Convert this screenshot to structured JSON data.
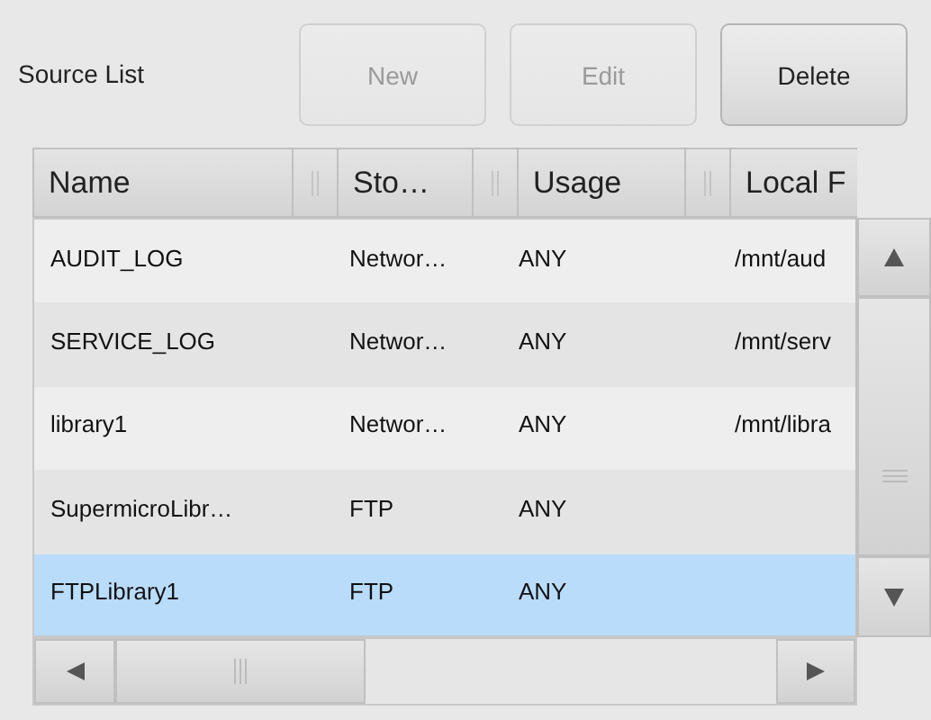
{
  "panel_label": "Source List",
  "buttons": [
    {
      "label": "New",
      "disabled": true
    },
    {
      "label": "Edit",
      "disabled": true
    },
    {
      "label": "Delete",
      "disabled": false
    }
  ],
  "table": {
    "columns": [
      "Name",
      "Sto…",
      "Usage",
      "Local F"
    ],
    "rows": [
      {
        "cells": [
          "AUDIT_LOG",
          "Networ…",
          "ANY",
          "/mnt/aud"
        ],
        "selected": false
      },
      {
        "cells": [
          "SERVICE_LOG",
          "Networ…",
          "ANY",
          "/mnt/serv"
        ],
        "selected": false
      },
      {
        "cells": [
          "library1",
          "Networ…",
          "ANY",
          "/mnt/libra"
        ],
        "selected": false
      },
      {
        "cells": [
          "SupermicroLibr…",
          "FTP",
          "ANY"
        ],
        "selected": false
      },
      {
        "cells": [
          "FTPLibrary1",
          "FTP",
          "ANY"
        ],
        "selected": true
      }
    ]
  }
}
